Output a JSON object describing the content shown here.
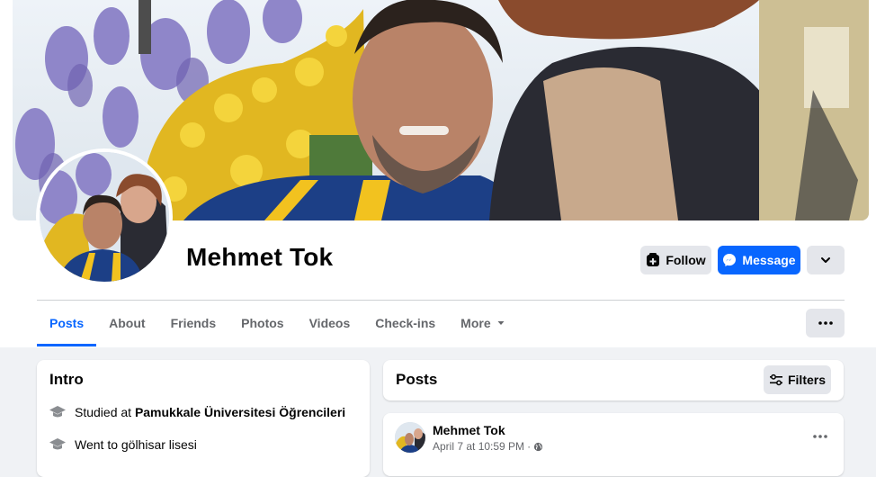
{
  "profile": {
    "name": "Mehmet Tok",
    "cover_photo": "cover-photo",
    "avatar": "profile-picture"
  },
  "actions": {
    "follow_label": "Follow",
    "follow_icon": "follow-plus-icon",
    "message_label": "Message",
    "message_icon": "messenger-icon",
    "more_icon": "chevron-down-icon"
  },
  "tabs": [
    {
      "label": "Posts",
      "active": true
    },
    {
      "label": "About"
    },
    {
      "label": "Friends"
    },
    {
      "label": "Photos"
    },
    {
      "label": "Videos"
    },
    {
      "label": "Check-ins"
    },
    {
      "label": "More",
      "icon": "caret-down-icon"
    }
  ],
  "tabs_more_icon": "ellipsis-icon",
  "intro": {
    "title": "Intro",
    "items": [
      {
        "prefix": "Studied at ",
        "bold": "Pamukkale Üniversitesi Öğrencileri",
        "icon": "graduation-cap-icon"
      },
      {
        "prefix": "Went to gölhisar lisesi",
        "bold": "",
        "icon": "graduation-cap-icon"
      }
    ]
  },
  "posts": {
    "title": "Posts",
    "filters_label": "Filters",
    "filters_icon": "filters-icon",
    "items": [
      {
        "author": "Mehmet Tok",
        "time": "April 7 at 10:59 PM",
        "separator": "·",
        "privacy_icon": "globe-icon",
        "menu_icon": "ellipsis-icon"
      }
    ]
  },
  "colors": {
    "brand_blue": "#0866ff",
    "page_bg": "#f0f2f5",
    "button_gray": "#e4e6eb",
    "secondary_text": "#65676b"
  }
}
